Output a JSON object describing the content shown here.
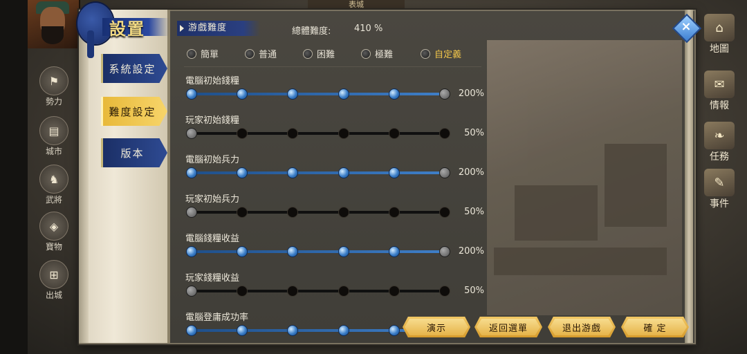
{
  "hud": {
    "city_name": "表城",
    "left_menu": [
      {
        "label": "勢力",
        "icon": "flag-icon"
      },
      {
        "label": "城市",
        "icon": "castle-icon"
      },
      {
        "label": "武將",
        "icon": "general-icon"
      },
      {
        "label": "寶物",
        "icon": "treasure-icon"
      },
      {
        "label": "出城",
        "icon": "gate-icon"
      }
    ],
    "right_menu": [
      {
        "label": "地圖",
        "icon": "map-icon"
      },
      {
        "label": "情報",
        "icon": "intel-icon"
      },
      {
        "label": "任務",
        "icon": "scroll-icon"
      },
      {
        "label": "事件",
        "icon": "event-icon"
      }
    ]
  },
  "dialog": {
    "title": "設置",
    "tabs": [
      {
        "label": "系統設定",
        "active": false
      },
      {
        "label": "難度設定",
        "active": true
      },
      {
        "label": "版本",
        "active": false
      }
    ],
    "section_title": "游戲難度",
    "overall_label": "總體難度:",
    "overall_value": "410 %",
    "difficulty_options": [
      {
        "label": "簡單",
        "selected": false
      },
      {
        "label": "普通",
        "selected": false
      },
      {
        "label": "困難",
        "selected": false
      },
      {
        "label": "極難",
        "selected": false
      },
      {
        "label": "自定義",
        "selected": true
      }
    ],
    "settings": [
      {
        "label": "電腦初始錢糧",
        "value": "200%",
        "level": 5,
        "style": "blue"
      },
      {
        "label": "玩家初始錢糧",
        "value": "50%",
        "level": 0,
        "style": "dark"
      },
      {
        "label": "電腦初始兵力",
        "value": "200%",
        "level": 5,
        "style": "blue"
      },
      {
        "label": "玩家初始兵力",
        "value": "50%",
        "level": 0,
        "style": "dark"
      },
      {
        "label": "電腦錢糧收益",
        "value": "200%",
        "level": 5,
        "style": "blue"
      },
      {
        "label": "玩家錢糧收益",
        "value": "50%",
        "level": 0,
        "style": "dark"
      },
      {
        "label": "電腦登庸成功率",
        "value": "",
        "level": 5,
        "style": "blue"
      }
    ],
    "buttons": {
      "demo": "演示",
      "back": "返回選單",
      "exit": "退出游戲",
      "ok": "確 定"
    }
  }
}
